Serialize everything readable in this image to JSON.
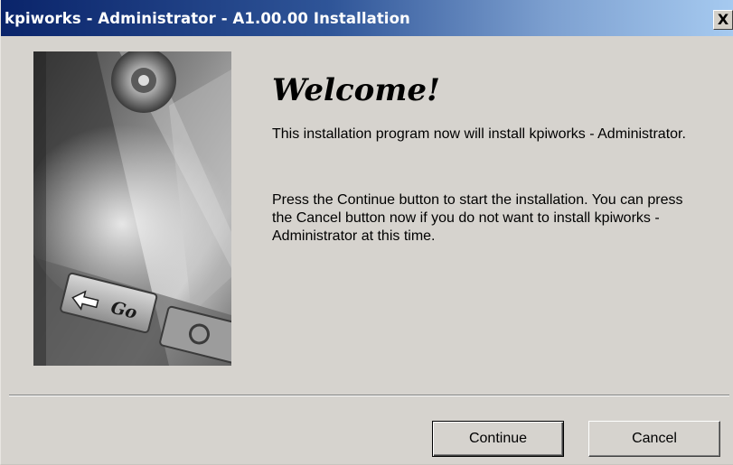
{
  "window": {
    "title": "kpiworks - Administrator - A1.00.00 Installation",
    "close_glyph": "X"
  },
  "hero_image": {
    "button_text": "Go",
    "icon": "arrow-swap-icon"
  },
  "content": {
    "heading": "Welcome!",
    "paragraph1": "This installation program now will install kpiworks - Administrator.",
    "paragraph2": "Press the Continue button to start the installation. You can press the Cancel button now if you do not want to install kpiworks - Administrator at this time."
  },
  "buttons": {
    "continue_label": "Continue",
    "cancel_label": "Cancel"
  },
  "colors": {
    "titlebar_start": "#0a246a",
    "titlebar_end": "#a6caf0",
    "dialog_face": "#d6d3ce"
  }
}
